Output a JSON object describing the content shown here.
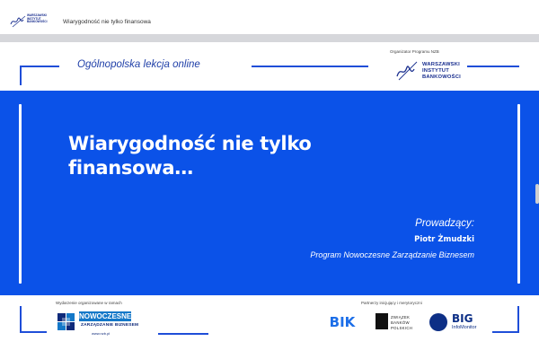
{
  "app": {
    "window_title": "Wiarygodność nie tylko finansowa",
    "logo_lines": [
      "WARSZAWSKI",
      "INSTYTUT",
      "BANKOWOŚCI"
    ]
  },
  "slide": {
    "lesson_title": "Ogólnopolska lekcja online",
    "organizer_label": "Organizator Programu NZB",
    "organizer_logo_lines": [
      "WARSZAWSKI",
      "INSTYTUT",
      "BANKOWOŚCI"
    ],
    "headline_line1": "Wiarygodność nie tylko",
    "headline_line2": "finansowa…",
    "host_label": "Prowadzący:",
    "host_name": "Piotr Żmudzki",
    "host_program": "Program Nowoczesne Zarządzanie Biznesem",
    "footer_left_label": "Wydarzenie organizowane w ramach",
    "footer_right_label": "Partnerzy inicjujący i merytoryczni",
    "nzb_badge": "NOWOCZESNE",
    "nzb_sub": "ZARZĄDZANIE BIZNESEM",
    "nzb_url": "www.nzb.pl",
    "bik_logo": "BIK",
    "zbp_lines": [
      "ZWIĄZEK",
      "BANKÓW",
      "POLSKICH"
    ],
    "big_logo": "BIG",
    "big_sub": "InfoMonitor"
  },
  "colors": {
    "panel_blue": "#0b52e8",
    "accent_navy": "#1a2f8f",
    "bracket_blue": "#1f4ed8"
  }
}
